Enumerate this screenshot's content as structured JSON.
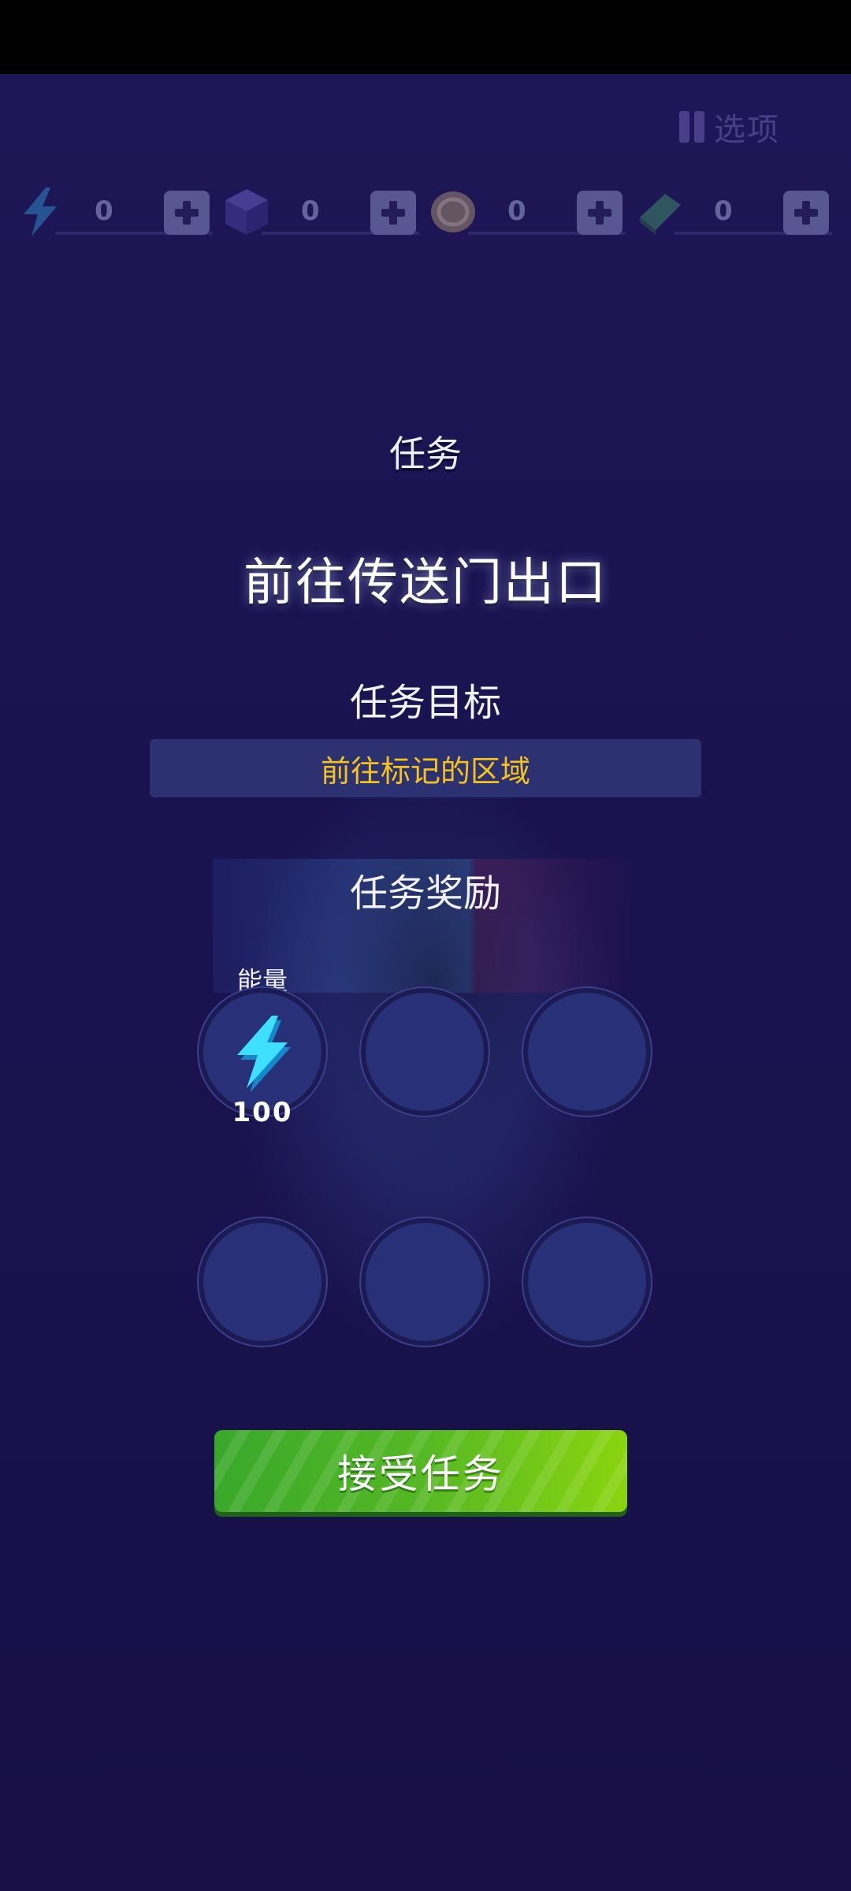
{
  "header": {
    "options_label": "选项"
  },
  "currencies": [
    {
      "icon": "energy-bolt-icon",
      "value": "0"
    },
    {
      "icon": "cube-icon",
      "value": "0"
    },
    {
      "icon": "coin-icon",
      "value": "0"
    },
    {
      "icon": "ticket-icon",
      "value": "0"
    }
  ],
  "mission": {
    "heading": "任务",
    "name": "前往传送门出口",
    "goal_heading": "任务目标",
    "goal_text": "前往标记的区域",
    "reward_heading": "任务奖励",
    "rewards": [
      {
        "label": "能量",
        "amount": "100",
        "icon": "energy-bolt-icon"
      },
      {
        "label": "",
        "amount": "",
        "icon": ""
      },
      {
        "label": "",
        "amount": "",
        "icon": ""
      },
      {
        "label": "",
        "amount": "",
        "icon": ""
      },
      {
        "label": "",
        "amount": "",
        "icon": ""
      },
      {
        "label": "",
        "amount": "",
        "icon": ""
      }
    ],
    "accept_label": "接受任务"
  },
  "colors": {
    "background": "#19124a",
    "goal_text": "#f5c21c",
    "accept_button": "#55b824"
  }
}
